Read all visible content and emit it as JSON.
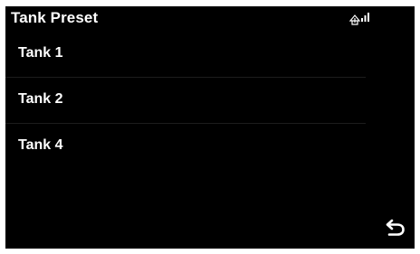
{
  "header": {
    "title": "Tank Preset",
    "status_icon": "signal-strength-icon"
  },
  "list": {
    "items": [
      {
        "label": "Tank 1"
      },
      {
        "label": "Tank 2"
      },
      {
        "label": "Tank 4"
      }
    ]
  },
  "footer": {
    "back_icon": "back-arrow-icon"
  },
  "colors": {
    "background": "#000000",
    "text": "#ffffff",
    "divider": "#1c1c1c",
    "bezel": "#ffffff"
  }
}
